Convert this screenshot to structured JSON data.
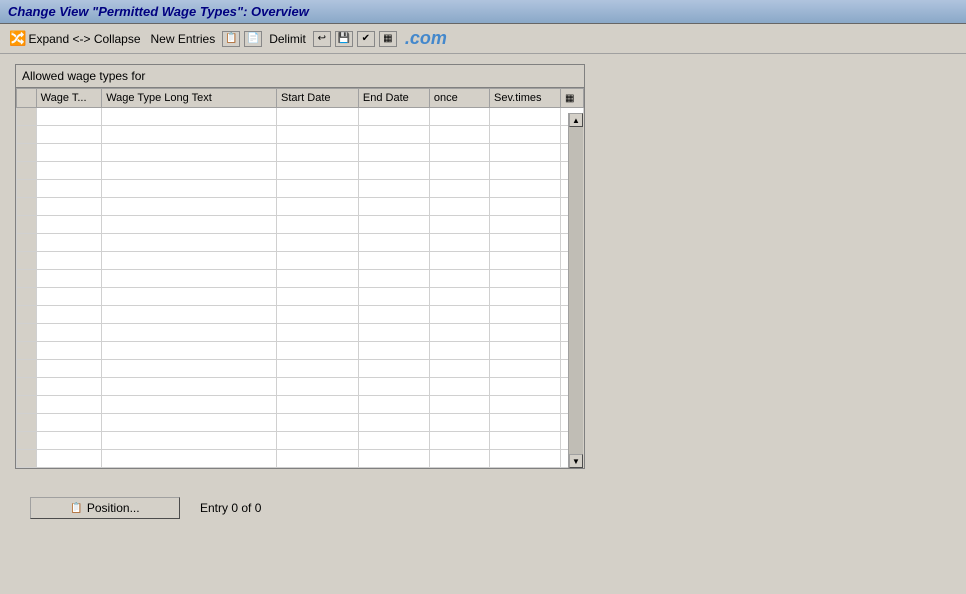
{
  "title": "Change View \"Permitted Wage Types\": Overview",
  "toolbar": {
    "expand_collapse_label": "Expand <-> Collapse",
    "new_entries_label": "New Entries",
    "delimit_label": "Delimit",
    "watermark": ".com"
  },
  "table": {
    "section_label": "Allowed wage types for",
    "columns": [
      {
        "id": "wage_t",
        "label": "Wage T..."
      },
      {
        "id": "wage_type_long_text",
        "label": "Wage Type Long Text"
      },
      {
        "id": "start_date",
        "label": "Start Date"
      },
      {
        "id": "end_date",
        "label": "End Date"
      },
      {
        "id": "once",
        "label": "once"
      },
      {
        "id": "sev_times",
        "label": "Sev.times"
      }
    ],
    "rows": 20
  },
  "bottom": {
    "position_button_label": "Position...",
    "entry_info": "Entry 0 of 0"
  }
}
